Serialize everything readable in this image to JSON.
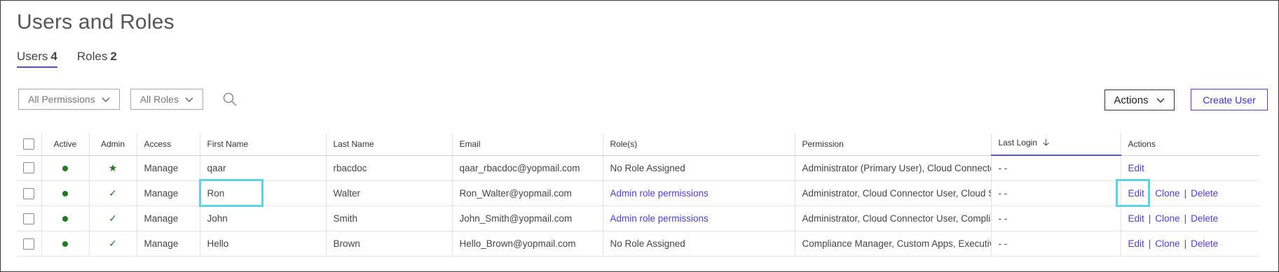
{
  "page": {
    "title": "Users and Roles"
  },
  "tabs": [
    {
      "label": "Users",
      "count": "4",
      "active": true
    },
    {
      "label": "Roles",
      "count": "2",
      "active": false
    }
  ],
  "filters": {
    "permissions": "All Permissions",
    "roles": "All Roles"
  },
  "toolbar": {
    "actions_label": "Actions",
    "create_label": "Create User"
  },
  "table": {
    "columns": [
      "Active",
      "Admin",
      "Access",
      "First Name",
      "Last Name",
      "Email",
      "Role(s)",
      "Permission",
      "Last Login",
      "Actions"
    ],
    "sorted_column": "Last Login",
    "rows": [
      {
        "active": true,
        "admin": "★",
        "access": "Manage",
        "first": "qaar",
        "last": "rbacdoc",
        "email": "qaar_rbacdoc@yopmail.com",
        "roles": "No Role Assigned",
        "roles_link": false,
        "permission": "Administrator (Primary User), Cloud Connector User",
        "last_login": "- -",
        "actions": [
          "Edit"
        ]
      },
      {
        "active": true,
        "admin": "✓",
        "access": "Manage",
        "first": "Ron",
        "last": "Walter",
        "email": "Ron_Walter@yopmail.com",
        "roles": "Admin role permissions",
        "roles_link": true,
        "permission": "Administrator, Cloud Connector User, Cloud Security",
        "last_login": "- -",
        "actions": [
          "Edit",
          "Clone",
          "Delete"
        ]
      },
      {
        "active": true,
        "admin": "✓",
        "access": "Manage",
        "first": "John",
        "last": "Smith",
        "email": "John_Smith@yopmail.com",
        "roles": "Admin role permissions",
        "roles_link": true,
        "permission": "Administrator, Cloud Connector User, Compliance",
        "last_login": "- -",
        "actions": [
          "Edit",
          "Clone",
          "Delete"
        ]
      },
      {
        "active": true,
        "admin": "✓",
        "access": "Manage",
        "first": "Hello",
        "last": "Brown",
        "email": "Hello_Brown@yopmail.com",
        "roles": "No Role Assigned",
        "roles_link": false,
        "permission": "Compliance Manager, Custom Apps, Executive",
        "last_login": "- -",
        "actions": [
          "Edit",
          "Clone",
          "Delete"
        ]
      }
    ]
  },
  "colors": {
    "accent": "#4a3fd1",
    "active_dot": "#1f7a1f",
    "highlight": "#5fd3e6"
  }
}
